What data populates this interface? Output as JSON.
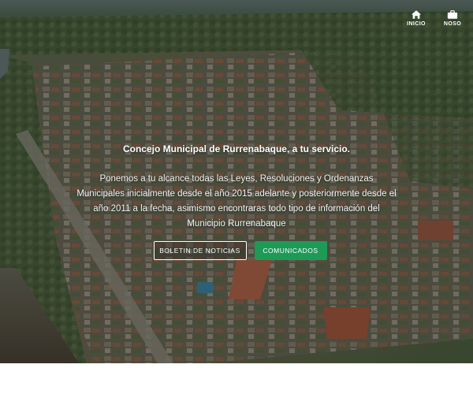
{
  "nav": {
    "items": [
      {
        "label": "INICIO",
        "icon": "home-icon"
      },
      {
        "label": "NOSO",
        "icon": "briefcase-icon"
      }
    ]
  },
  "hero": {
    "title": "Concejo Municipal de Rurrenabaque, a tu servicio.",
    "description": "Ponemos a tu alcance todas las Leyes, Resoluciones y Ordenanzas Municipales inicialmente desde el año 2015 adelante y posteriormente desde el año 2011 a la fecha, asimismo encontraras todo tipo de información del Municipio Rurrenabaque",
    "buttons": {
      "news": "BOLETIN DE NOTICIAS",
      "comms": "COMUNICADOS"
    }
  },
  "colors": {
    "accent_green": "#1e9a57",
    "overlay": "rgba(20,25,20,0.38)"
  }
}
